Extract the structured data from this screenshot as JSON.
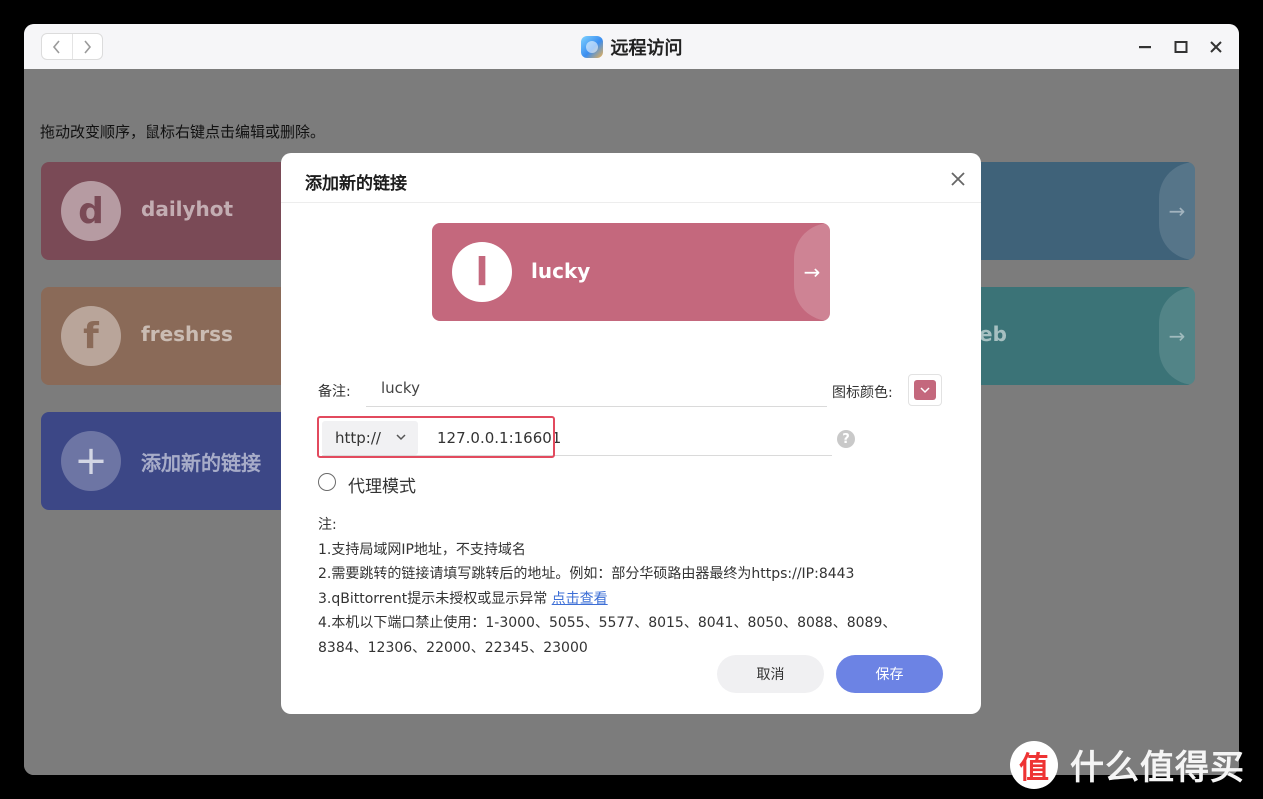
{
  "window": {
    "title": "远程访问",
    "icons": {
      "app": "remote-access-app-icon",
      "back": "chevron-left-icon",
      "forward": "chevron-right-icon",
      "minimize": "minimize-icon",
      "maximize": "maximize-icon",
      "close": "close-icon"
    }
  },
  "page": {
    "hint": "拖动改变顺序，鼠标右键点击编辑或删除。"
  },
  "cards": [
    {
      "id": "dailyhot",
      "letter": "d",
      "name": "dailyhot",
      "color": "#7a4a56",
      "arrow": "→"
    },
    {
      "id": "card-2",
      "letter": "",
      "name": "",
      "color": "#444c70",
      "arrow": "→"
    },
    {
      "id": "card-3",
      "letter": "",
      "name": "",
      "color": "#3f6279",
      "arrow": "→"
    },
    {
      "id": "freshrss",
      "letter": "f",
      "name": "freshrss",
      "color": "#8a6a58",
      "arrow": "→"
    },
    {
      "id": "card-5",
      "letter": "",
      "name": "",
      "color": "#3d6a8a",
      "arrow": "→"
    },
    {
      "id": "card-6",
      "letter": "",
      "name": "eb",
      "color": "#3b7377",
      "arrow": "→"
    },
    {
      "id": "add",
      "letter": "+",
      "name": "添加新的链接",
      "color": "#3c4786"
    }
  ],
  "modal": {
    "title": "添加新的链接",
    "preview": {
      "letter": "l",
      "name": "lucky",
      "color": "#c4687d",
      "arrow": "→"
    },
    "note_label": "备注:",
    "note_value": "lucky",
    "icon_color_label": "图标颜色:",
    "icon_color": "#c4687d",
    "protocol": "http://",
    "address": "127.0.0.1:16601",
    "help": "?",
    "proxy_label": "代理模式",
    "notes": {
      "heading": "注:",
      "line1": "1.支持局域网IP地址，不支持域名",
      "line2": "2.需要跳转的链接请填写跳转后的地址。例如：部分华硕路由器最终为https://IP:8443",
      "line3_prefix": "3.qBittorrent提示未授权或显示异常 ",
      "line3_link": "点击查看",
      "line4a": "4.本机以下端口禁止使用：1-3000、5055、5577、8015、8041、8050、8088、8089、",
      "line4b": "8384、12306、22000、22345、23000"
    },
    "cancel_label": "取消",
    "save_label": "保存"
  },
  "watermark": {
    "badge": "值",
    "text": "什么值得买"
  }
}
